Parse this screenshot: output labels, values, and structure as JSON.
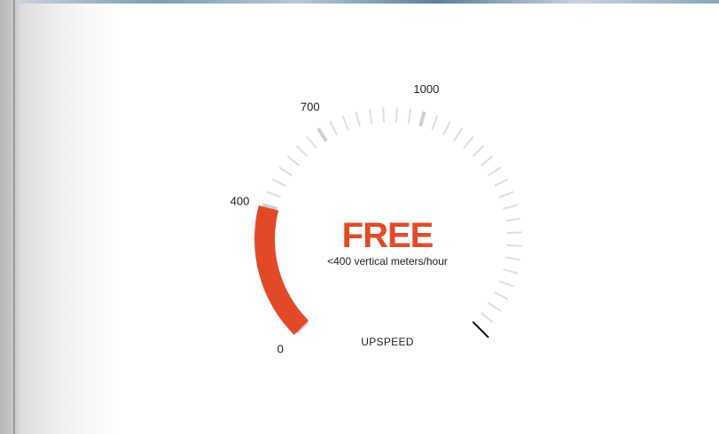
{
  "gauge": {
    "title": "FREE",
    "subtitle": "<400 vertical meters/hour",
    "name": "UPSPEED",
    "min": 0,
    "max": 1000,
    "value": 400,
    "scale_labels": [
      {
        "value": 0,
        "text": "0"
      },
      {
        "value": 400,
        "text": "400"
      },
      {
        "value": 700,
        "text": "700"
      },
      {
        "value": 1000,
        "text": "1000"
      }
    ],
    "colors": {
      "accent": "#e24a27",
      "tick": "#dedede",
      "major_tick": "#cfcfcf",
      "needle": "#111111"
    }
  }
}
